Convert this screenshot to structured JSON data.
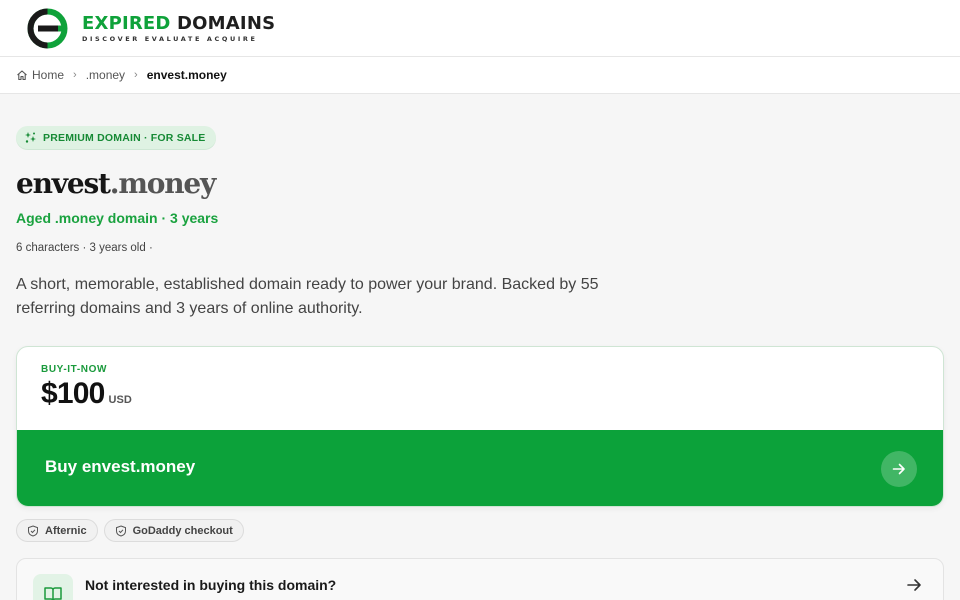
{
  "brand": {
    "name_part1": "EXPIRED",
    "name_part2": "DOMAINS",
    "tagline": "DISCOVER EVALUATE ACQUIRE",
    "accent": "#0fa23a"
  },
  "breadcrumb": {
    "items": [
      {
        "label": "Home",
        "icon": "home-icon"
      },
      {
        "label": ".money"
      },
      {
        "label": "envest.money",
        "current": true
      }
    ]
  },
  "badge": {
    "label": "PREMIUM DOMAIN · FOR SALE",
    "icon": "sparkle-icon"
  },
  "domain": {
    "sld": "envest",
    "tld": ".money",
    "subtitle": "Aged .money domain · 3 years",
    "meta": "6 characters · 3 years old ·",
    "description": "A short, memorable, established domain ready to power your brand. Backed by 55 referring domains and 3 years of online authority."
  },
  "pricing": {
    "label": "BUY-IT-NOW",
    "price": "$100",
    "currency": "USD",
    "buy_label": "Buy envest.money",
    "button_color": "#0ca23a"
  },
  "chips": [
    {
      "label": "Afternic",
      "icon": "shield-icon"
    },
    {
      "label": "GoDaddy checkout",
      "icon": "shield-icon"
    }
  ],
  "not_interested": {
    "label": "Not interested in buying this domain?",
    "icon": "book-icon"
  }
}
